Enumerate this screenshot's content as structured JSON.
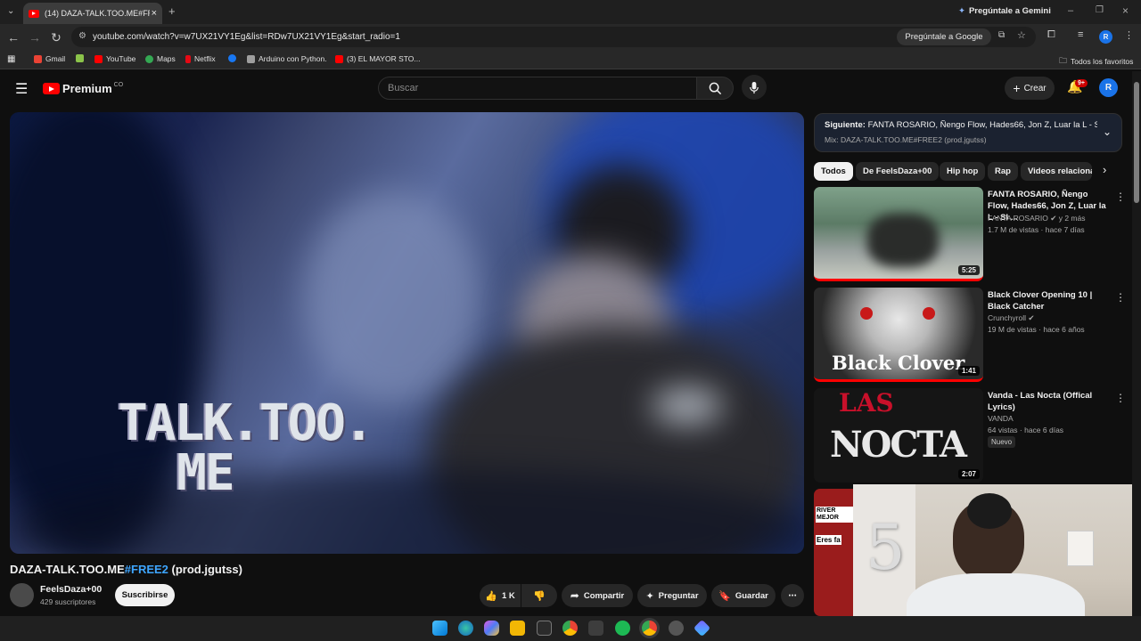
{
  "browser": {
    "tab_title": "(14) DAZA-TALK.TOO.ME#FREE2",
    "gemini_top": "Pregúntale a Gemini",
    "url": "youtube.com/watch?v=w7UX21VY1Eg&list=RDw7UX21VY1Eg&start_radio=1",
    "gemini_pill": "Pregúntale a Google",
    "profile_initial": "R",
    "bookmarks": [
      "Gmail",
      "YouTube",
      "Maps",
      "Netflix",
      "Arduino con Python.",
      "(3) EL MAYOR STO..."
    ],
    "all_bookmarks": "Todos los favoritos"
  },
  "masthead": {
    "logo": "Premium",
    "country": "CO",
    "search_placeholder": "Buscar",
    "create": "Crear",
    "notif_count": "9+",
    "avatar_initial": "R"
  },
  "video": {
    "overlay_line1": "TALK.TOO.",
    "overlay_line2": "ME",
    "title_main": "DAZA-TALK.TOO.ME",
    "title_tag": "#FREE2",
    "title_end": " (prod.jgutss)",
    "channel": "FeelsDaza+00",
    "subscribers": "429 suscriptores",
    "subscribe": "Suscribirse",
    "likes": "1 K",
    "share": "Compartir",
    "ask": "Preguntar",
    "save": "Guardar"
  },
  "sidebar": {
    "next_label": "Siguiente:",
    "next_title": "FANTA ROSARIO, Ñengo Flow, Hades66, Jon Z, Luar la L - SI ...",
    "next_sub": "Mix: DAZA-TALK.TOO.ME#FREE2 (prod.jgutss)",
    "chips": [
      "Todos",
      "De FeelsDaza+00",
      "Hip hop",
      "Rap",
      "Videos relacionad"
    ],
    "recs": [
      {
        "title": "FANTA ROSARIO, Ñengo Flow, Hades66, Jon Z,  Luar la L - SI ...",
        "channel": "FANTA ROSARIO",
        "extra": "y 2 más",
        "meta": "1.7 M de vistas · hace 7 días",
        "duration": "5:25"
      },
      {
        "title": "Black Clover Opening 10 | Black Catcher",
        "channel": "Crunchyroll",
        "extra": "",
        "meta": "19 M de vistas · hace 6 años",
        "duration": "1:41",
        "thumb_text": "Black Clover"
      },
      {
        "title": "Vanda - Las Nocta (Offical Lyrics)",
        "channel": "VANDA",
        "extra": "",
        "meta": "64 vistas · hace 6 días",
        "badge": "Nuevo",
        "duration": "2:07",
        "thumb_line1": "LAS",
        "thumb_line2": "NOCTA"
      }
    ],
    "partial_thumb": [
      "RIVER MEJOR",
      "Eres fa"
    ]
  },
  "colors": {
    "brand": "#ff0000",
    "link": "#3ea6ff",
    "background": "#0f0f0f"
  }
}
